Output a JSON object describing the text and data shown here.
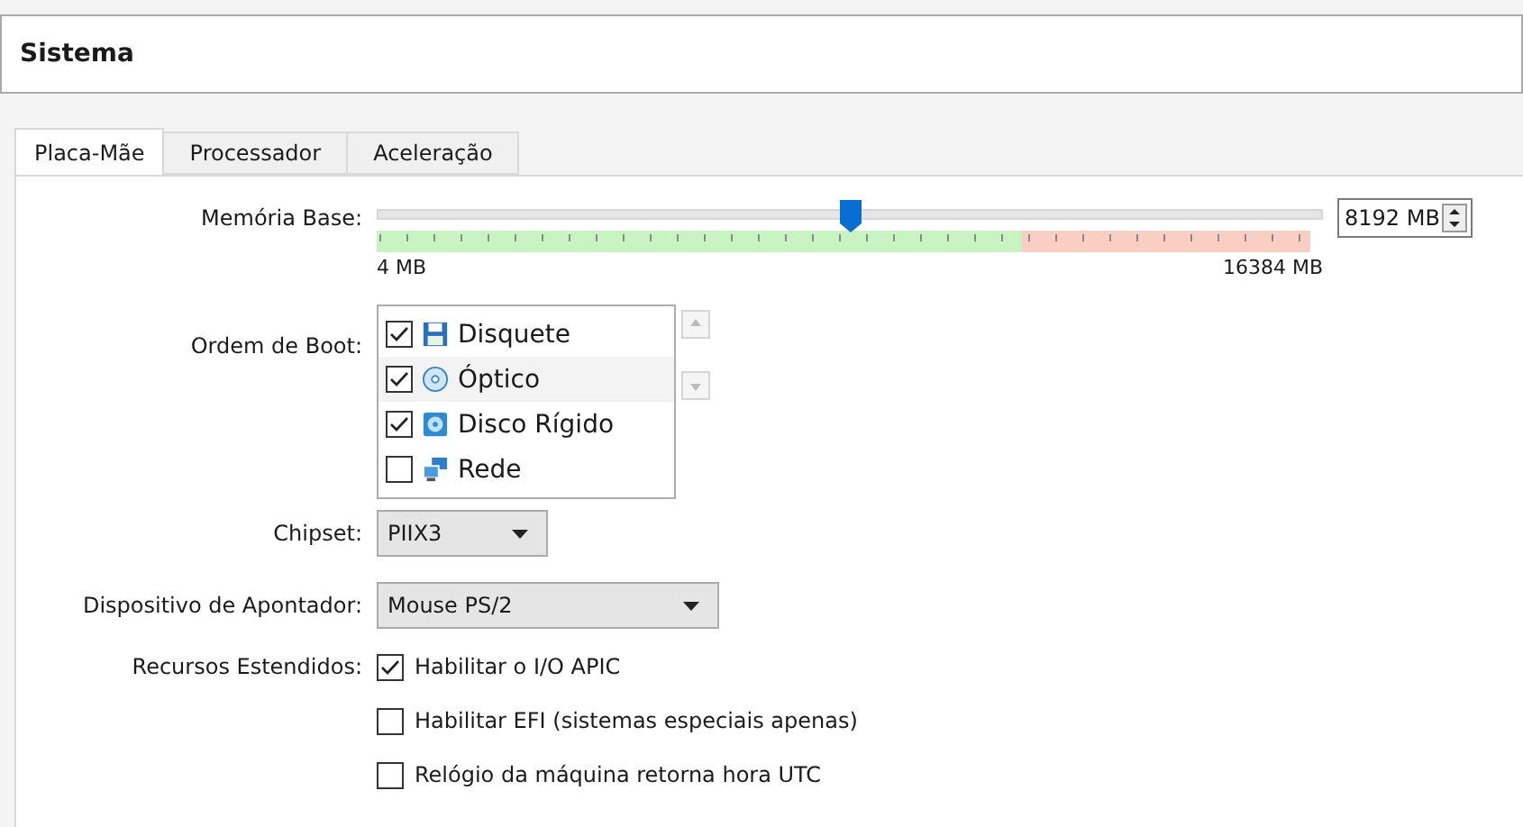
{
  "header": {
    "title": "Sistema"
  },
  "tabs": [
    {
      "label": "Placa-Mãe",
      "selected": true
    },
    {
      "label": "Processador",
      "selected": false
    },
    {
      "label": "Aceleração",
      "selected": false
    }
  ],
  "memory": {
    "label": "Memória Base:",
    "level": 0.5,
    "min_label": "4 MB",
    "max_label": "16384 MB",
    "value": "8192 MB"
  },
  "boot_order": {
    "label": "Ordem de Boot:",
    "items": [
      {
        "label": "Disquete",
        "kind": "floppy",
        "checked": true
      },
      {
        "label": "Óptico",
        "kind": "optical",
        "checked": true
      },
      {
        "label": "Disco Rígido",
        "kind": "harddisk",
        "checked": true
      },
      {
        "label": "Rede",
        "kind": "network",
        "checked": false
      }
    ]
  },
  "chipset": {
    "label": "Chipset:",
    "value": "PIIX3"
  },
  "pointing_device": {
    "label": "Dispositivo de Apontador:",
    "value": "Mouse PS/2"
  },
  "extended_features": {
    "label": "Recursos Estendidos:",
    "options": [
      {
        "label": "Habilitar o I/O APIC",
        "checked": true
      },
      {
        "label": "Habilitar EFI (sistemas especiais apenas)",
        "checked": false
      },
      {
        "label": "Relógio da máquina retorna hora UTC",
        "checked": false
      }
    ]
  }
}
